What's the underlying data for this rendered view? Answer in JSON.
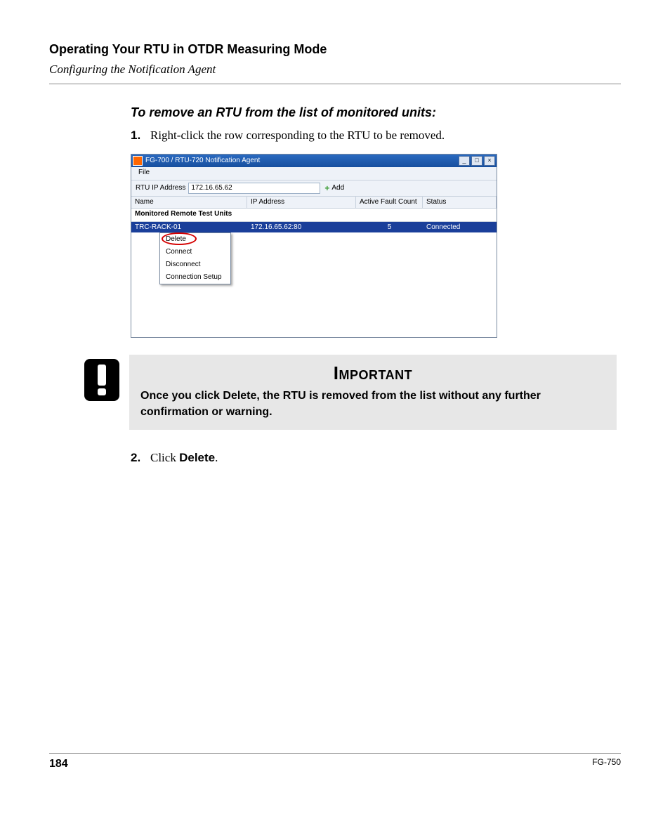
{
  "header": {
    "title": "Operating Your RTU in OTDR Measuring Mode",
    "subtitle": "Configuring the Notification Agent"
  },
  "task_heading": "To remove an RTU from the list of monitored units:",
  "steps": [
    {
      "num": "1.",
      "text": "Right-click the row corresponding to the RTU to be removed."
    },
    {
      "num": "2.",
      "pre": "Click ",
      "bold": "Delete",
      "post": "."
    }
  ],
  "screenshot": {
    "window_title": "FG-700 / RTU-720 Notification Agent",
    "win_buttons": {
      "min": "_",
      "max": "□",
      "close": "×"
    },
    "menu": {
      "file": "File"
    },
    "address_row": {
      "label": "RTU IP Address",
      "value": "172.16.65.62",
      "add_label": "Add"
    },
    "columns": {
      "name": "Name",
      "ip": "IP Address",
      "afc": "Active Fault Count",
      "status": "Status"
    },
    "section_label": "Monitored Remote Test Units",
    "row": {
      "name": "TRC-RACK-01",
      "ip": "172.16.65.62:80",
      "afc": "5",
      "status": "Connected"
    },
    "context_menu": [
      "Delete",
      "Connect",
      "Disconnect",
      "Connection Setup"
    ]
  },
  "important": {
    "title": "Important",
    "body": "Once you click Delete, the RTU is removed from the list without any further confirmation or warning."
  },
  "footer": {
    "page": "184",
    "doc": "FG-750"
  }
}
